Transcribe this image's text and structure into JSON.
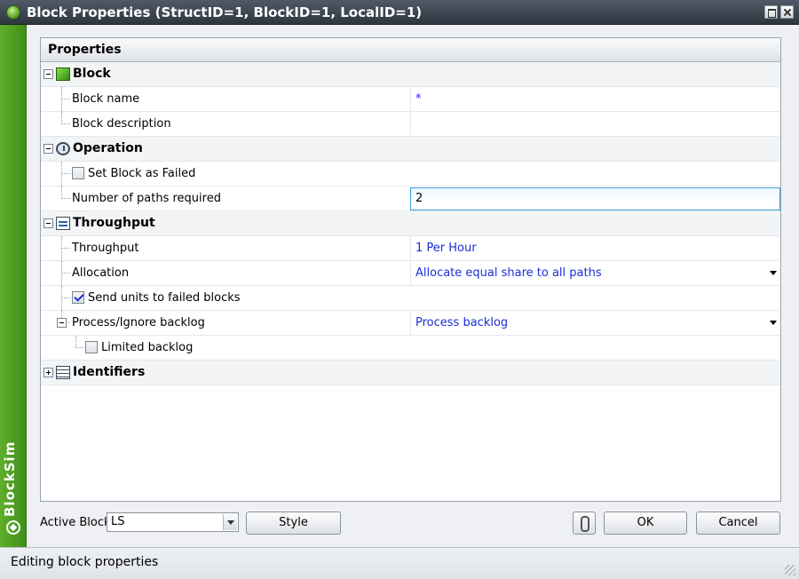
{
  "window": {
    "title": "Block Properties (StructID=1, BlockID=1, LocalID=1)"
  },
  "brand": {
    "name": "BlockSim"
  },
  "panel": {
    "header": "Properties",
    "categories": {
      "block": {
        "label": "Block",
        "rows": {
          "name": {
            "label": "Block name",
            "value": "*"
          },
          "description": {
            "label": "Block description",
            "value": ""
          }
        }
      },
      "operation": {
        "label": "Operation",
        "rows": {
          "set_failed": {
            "label": "Set Block as Failed",
            "checked": false
          },
          "paths_required": {
            "label": "Number of paths required",
            "value": "2"
          }
        }
      },
      "throughput": {
        "label": "Throughput",
        "rows": {
          "throughput": {
            "label": "Throughput",
            "value": "1 Per Hour"
          },
          "allocation": {
            "label": "Allocation",
            "value": "Allocate equal share to all paths"
          },
          "send_failed": {
            "label": "Send units to failed blocks",
            "checked": true
          },
          "backlog": {
            "label": "Process/Ignore backlog",
            "value": "Process backlog"
          },
          "limited_backlog": {
            "label": "Limited backlog",
            "checked": false
          }
        }
      },
      "identifiers": {
        "label": "Identifiers"
      }
    }
  },
  "footer": {
    "active_block_label": "Active Block",
    "active_block_value": "LS",
    "style_button": "Style",
    "ok_button": "OK",
    "cancel_button": "Cancel"
  },
  "status": {
    "text": "Editing block properties"
  },
  "colors": {
    "value_text": "#1a2fd6",
    "brand_green": "#4f9e22",
    "title_bar": "#3a434d"
  }
}
